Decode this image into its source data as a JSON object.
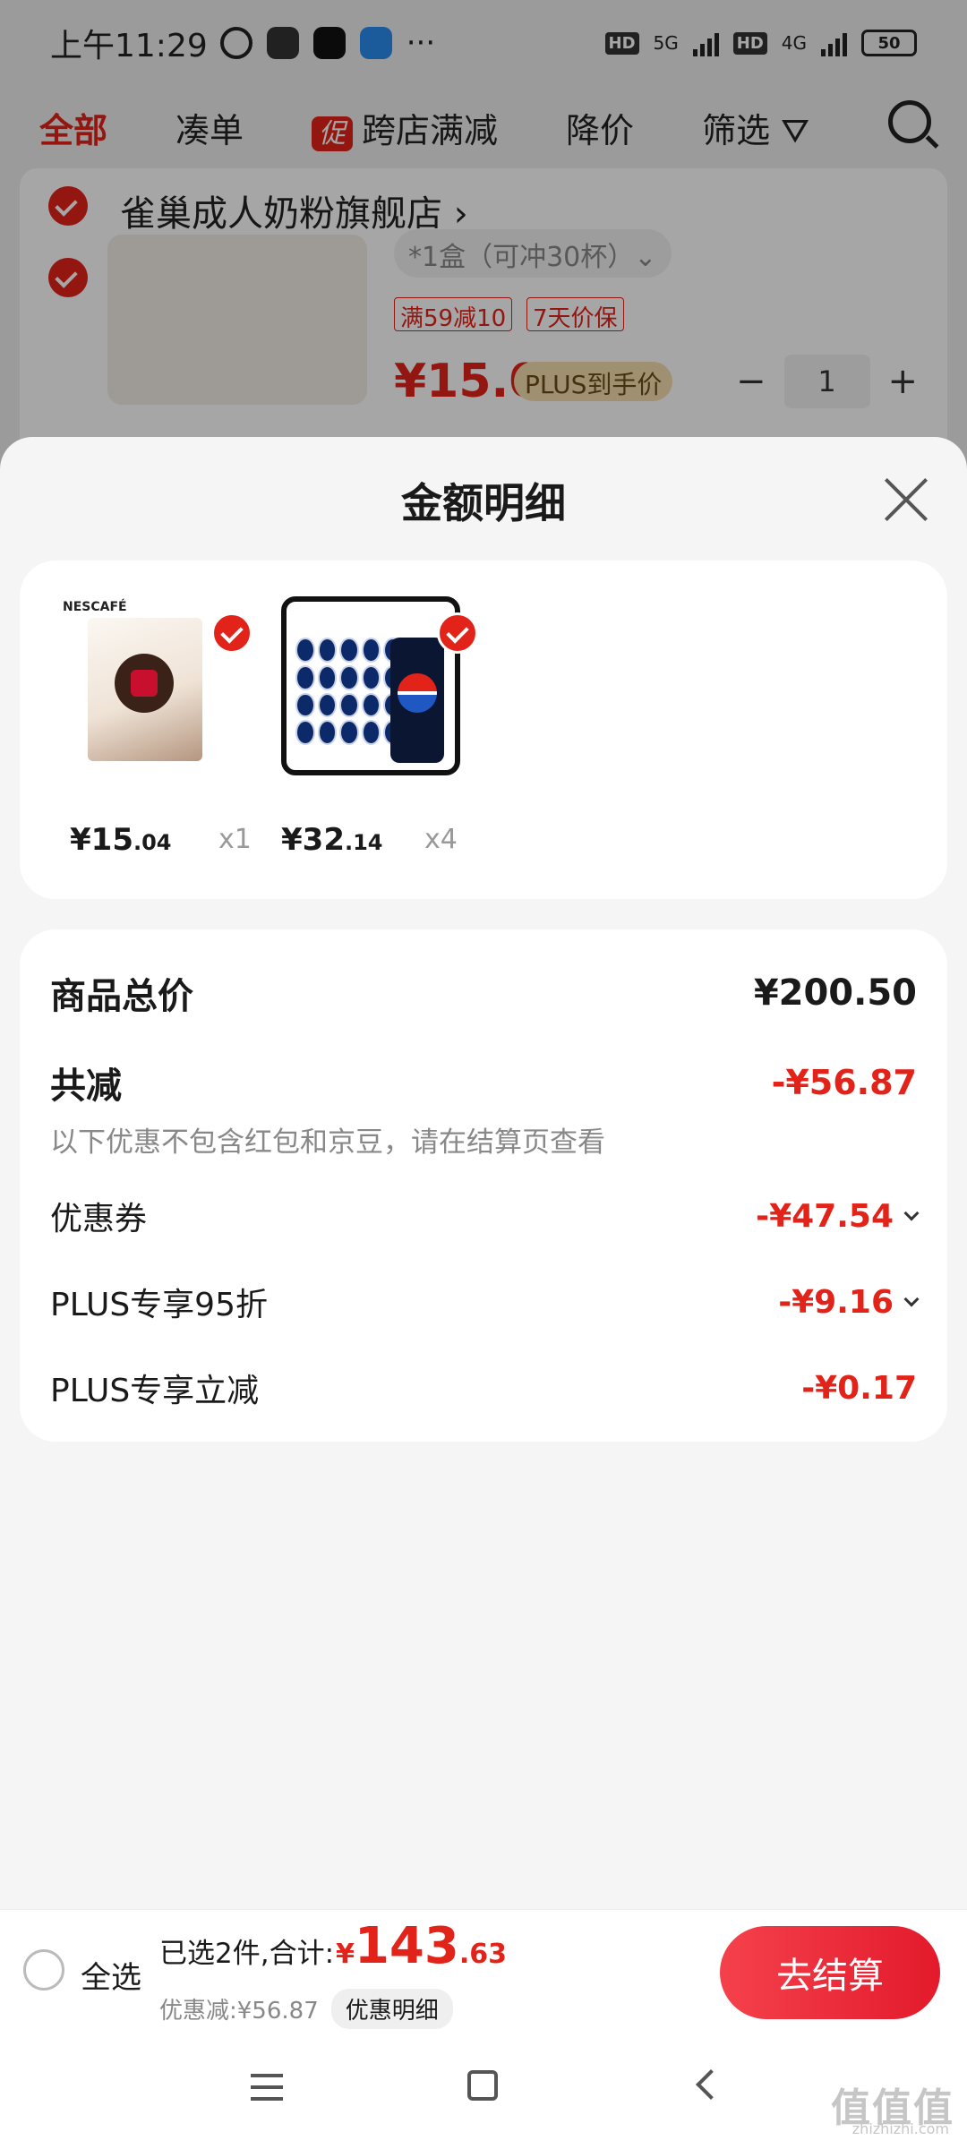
{
  "status_bar": {
    "time": "上午11:29",
    "network1": "5G",
    "network2": "4G",
    "battery": "50"
  },
  "filter_bar": {
    "tabs": [
      "全部",
      "凑单",
      "跨店满减",
      "降价",
      "筛选"
    ],
    "promo_badge": "促"
  },
  "background_cart": {
    "shop_name": "雀巢成人奶粉旗舰店 ›",
    "spec": "*1盒（可冲30杯）⌄",
    "tags": [
      "满59减10",
      "7天价保"
    ],
    "price": "¥15.04",
    "plus_badge": "PLUS到手价",
    "quantity": "1",
    "minus": "−",
    "plus": "+"
  },
  "sheet": {
    "title": "金额明细",
    "products": [
      {
        "price_int": "¥15",
        "price_dec": ".04",
        "qty": "x1",
        "logo_text": "NESCAFÉ"
      },
      {
        "price_int": "¥32",
        "price_dec": ".14",
        "qty": "x4"
      }
    ],
    "detail": {
      "total_label": "商品总价",
      "total_value": "¥200.50",
      "reduce_label": "共减",
      "reduce_value": "-¥56.87",
      "note": "以下优惠不包含红包和京豆，请在结算页查看",
      "items": [
        {
          "label": "优惠券",
          "value": "-¥47.54"
        },
        {
          "label": "PLUS专享95折",
          "value": "-¥9.16"
        },
        {
          "label": "PLUS专享立减",
          "value": "-¥0.17"
        }
      ]
    }
  },
  "checkout": {
    "select_all": "全选",
    "summary_text": "已选2件,合计:",
    "currency": "¥",
    "total_int": "143",
    "total_dec": ".63",
    "discount_text": "优惠减:¥56.87",
    "discount_detail": "优惠明细",
    "checkout_button": "去结算"
  },
  "watermark": {
    "text": "值值值",
    "sub": "zhizhizhi.com"
  },
  "colors": {
    "accent": "#e2231a",
    "button_gradient_start": "#f5414c",
    "button_gradient_end": "#e31a2b"
  }
}
